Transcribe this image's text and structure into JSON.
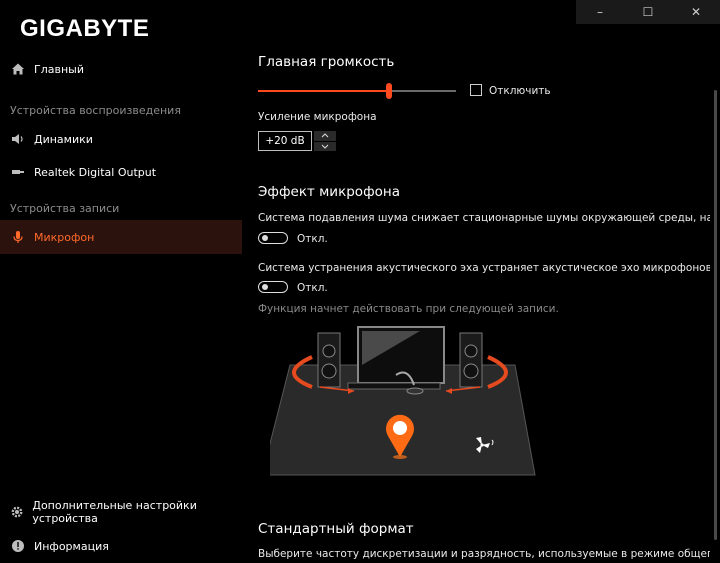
{
  "window": {
    "brand": "GIGABYTE",
    "controls": {
      "minimize": "–",
      "maximize": "☐",
      "close": "✕"
    }
  },
  "sidebar": {
    "main_item": "Главный",
    "section_playback": "Устройства воспроизведения",
    "playback_items": [
      "Динамики",
      "Realtek Digital Output"
    ],
    "section_record": "Устройства записи",
    "record_items": [
      "Микрофон"
    ],
    "bottom_items": [
      "Дополнительные настройки устройства",
      "Информация"
    ]
  },
  "main": {
    "volume_title": "Главная громкость",
    "volume_level": 0.66,
    "mute_label": "Отключить",
    "mic_boost_label": "Усиление микрофона",
    "mic_boost_value": "+20 dB",
    "mic_effect_title": "Эффект микрофона",
    "noise_suppression_text": "Система подавления шума снижает стационарные шумы окружающей среды, например, шум",
    "noise_suppression_state": "Откл.",
    "echo_cancellation_text": "Система устранения акустического эха устраняет акустическое эхо микрофонов через выход к",
    "echo_cancellation_state": "Откл.",
    "notice_text": "Функция начнет действовать при следующей записи.",
    "default_format_title": "Стандартный формат",
    "default_format_text": "Выберите частоту дискретизации и разрядность, используемые в режиме общего доступа."
  },
  "colors": {
    "accent": "#ff4a1f",
    "active_bg": "#2b120d",
    "background": "#000000"
  }
}
